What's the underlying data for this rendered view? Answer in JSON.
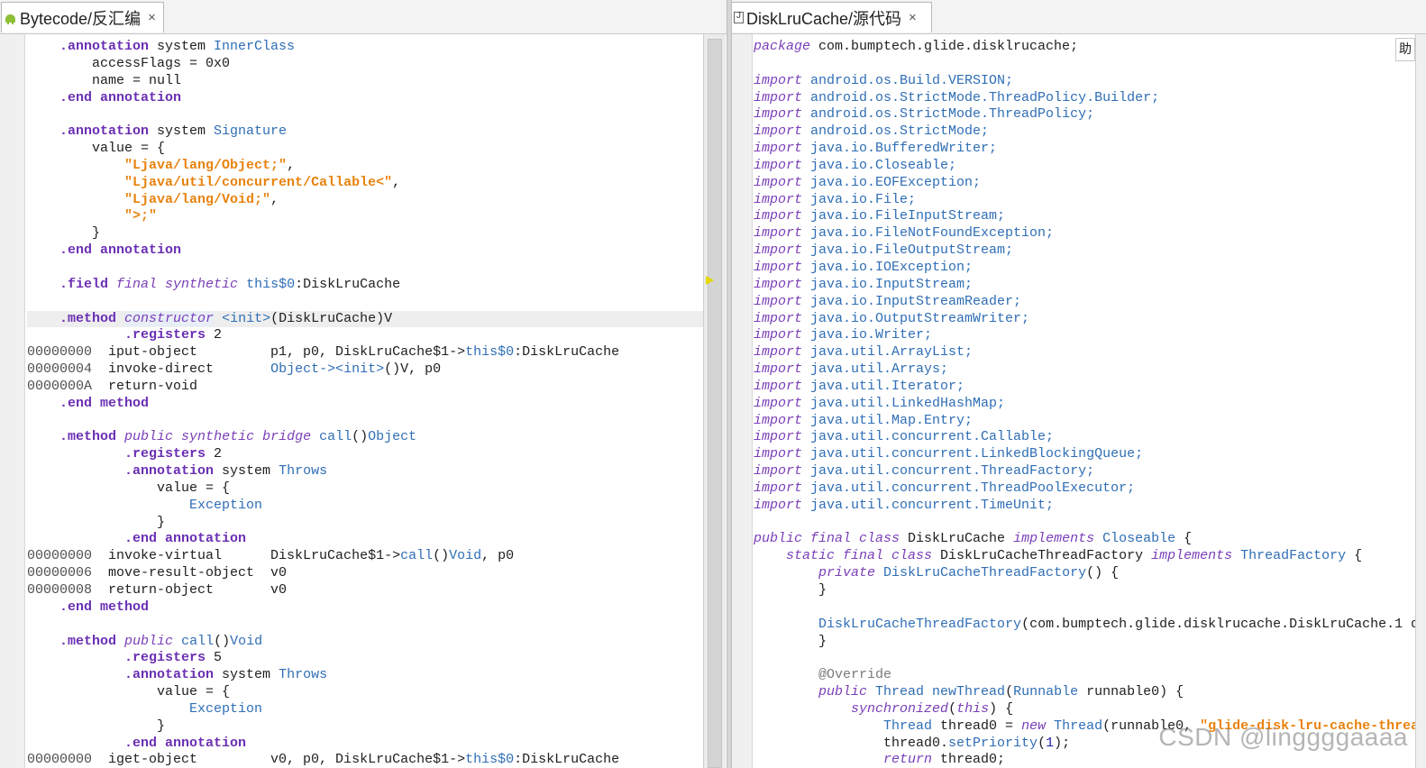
{
  "left_tab": {
    "label": "Bytecode/反汇编",
    "close": "×",
    "icon": "android-icon"
  },
  "right_tab": {
    "label": "DiskLruCache/源代码",
    "close": "×",
    "icon": "java-file-icon"
  },
  "side_glyph": "助",
  "watermark": "CSDN @linggggaaaa",
  "colors": {
    "directive": "#6a2fb3",
    "keyword": "#7a3fb8",
    "type": "#2f6eb5",
    "string": "#e8820e",
    "scroll_marker": "#e6d800"
  },
  "bytecode_lines": [
    [
      [
        "    .annotation",
        "dir"
      ],
      [
        " system ",
        "plain"
      ],
      [
        "InnerClass",
        "type"
      ]
    ],
    [
      [
        "        accessFlags = 0x0",
        "plain"
      ]
    ],
    [
      [
        "        name = null",
        "plain"
      ]
    ],
    [
      [
        "    .end annotation",
        "dir"
      ]
    ],
    [
      [
        "",
        "plain"
      ]
    ],
    [
      [
        "    .annotation",
        "dir"
      ],
      [
        " system ",
        "plain"
      ],
      [
        "Signature",
        "type"
      ]
    ],
    [
      [
        "        value = {",
        "plain"
      ]
    ],
    [
      [
        "            ",
        "plain"
      ],
      [
        "\"Ljava/lang/Object;\"",
        "str"
      ],
      [
        ",",
        "plain"
      ]
    ],
    [
      [
        "            ",
        "plain"
      ],
      [
        "\"Ljava/util/concurrent/Callable<\"",
        "str"
      ],
      [
        ",",
        "plain"
      ]
    ],
    [
      [
        "            ",
        "plain"
      ],
      [
        "\"Ljava/lang/Void;\"",
        "str"
      ],
      [
        ",",
        "plain"
      ]
    ],
    [
      [
        "            ",
        "plain"
      ],
      [
        "\">;\"",
        "str"
      ]
    ],
    [
      [
        "        }",
        "plain"
      ]
    ],
    [
      [
        "    .end annotation",
        "dir"
      ]
    ],
    [
      [
        "",
        "plain"
      ]
    ],
    [
      [
        "    .field",
        "dir"
      ],
      [
        " ",
        "plain"
      ],
      [
        "final synthetic",
        "kw"
      ],
      [
        " this$0",
        "ref"
      ],
      [
        ":DiskLruCache",
        "plain"
      ]
    ],
    [
      [
        "",
        "plain"
      ]
    ],
    [
      [
        "    .method",
        "dir"
      ],
      [
        " ",
        "plain"
      ],
      [
        "constructor",
        "sel"
      ],
      [
        " <init>",
        "ref"
      ],
      [
        "(DiskLruCache)V",
        "plain"
      ]
    ],
    [
      [
        "            .registers",
        "dir"
      ],
      [
        " 2",
        "plain"
      ]
    ],
    [
      [
        "00000000",
        "off"
      ],
      [
        "  iput-object         p1, p0, DiskLruCache$1->",
        "plain"
      ],
      [
        "this$0",
        "ref"
      ],
      [
        ":DiskLruCache",
        "plain"
      ]
    ],
    [
      [
        "00000004",
        "off"
      ],
      [
        "  invoke-direct       ",
        "plain"
      ],
      [
        "Object-><init>",
        "ref"
      ],
      [
        "()V, p0",
        "plain"
      ]
    ],
    [
      [
        "0000000A",
        "off"
      ],
      [
        "  return-void",
        "plain"
      ]
    ],
    [
      [
        "    .end method",
        "dir"
      ]
    ],
    [
      [
        "",
        "plain"
      ]
    ],
    [
      [
        "    .method",
        "dir"
      ],
      [
        " ",
        "plain"
      ],
      [
        "public synthetic bridge",
        "kw"
      ],
      [
        " call",
        "ref"
      ],
      [
        "()",
        "plain"
      ],
      [
        "Object",
        "type"
      ]
    ],
    [
      [
        "            .registers",
        "dir"
      ],
      [
        " 2",
        "plain"
      ]
    ],
    [
      [
        "            .annotation",
        "dir"
      ],
      [
        " system ",
        "plain"
      ],
      [
        "Throws",
        "type"
      ]
    ],
    [
      [
        "                value = {",
        "plain"
      ]
    ],
    [
      [
        "                    ",
        "plain"
      ],
      [
        "Exception",
        "type"
      ]
    ],
    [
      [
        "                }",
        "plain"
      ]
    ],
    [
      [
        "            .end annotation",
        "dir"
      ]
    ],
    [
      [
        "00000000",
        "off"
      ],
      [
        "  invoke-virtual      DiskLruCache$1->",
        "plain"
      ],
      [
        "call",
        "ref"
      ],
      [
        "()",
        "plain"
      ],
      [
        "Void",
        "type"
      ],
      [
        ", p0",
        "plain"
      ]
    ],
    [
      [
        "00000006",
        "off"
      ],
      [
        "  move-result-object  v0",
        "plain"
      ]
    ],
    [
      [
        "00000008",
        "off"
      ],
      [
        "  return-object       v0",
        "plain"
      ]
    ],
    [
      [
        "    .end method",
        "dir"
      ]
    ],
    [
      [
        "",
        "plain"
      ]
    ],
    [
      [
        "    .method",
        "dir"
      ],
      [
        " ",
        "plain"
      ],
      [
        "public",
        "kw"
      ],
      [
        " call",
        "ref"
      ],
      [
        "()",
        "plain"
      ],
      [
        "Void",
        "type"
      ]
    ],
    [
      [
        "            .registers",
        "dir"
      ],
      [
        " 5",
        "plain"
      ]
    ],
    [
      [
        "            .annotation",
        "dir"
      ],
      [
        " system ",
        "plain"
      ],
      [
        "Throws",
        "type"
      ]
    ],
    [
      [
        "                value = {",
        "plain"
      ]
    ],
    [
      [
        "                    ",
        "plain"
      ],
      [
        "Exception",
        "type"
      ]
    ],
    [
      [
        "                }",
        "plain"
      ]
    ],
    [
      [
        "            .end annotation",
        "dir"
      ]
    ],
    [
      [
        "00000000",
        "off"
      ],
      [
        "  iget-object         v0, p0, DiskLruCache$1->",
        "plain"
      ],
      [
        "this$0",
        "ref"
      ],
      [
        ":DiskLruCache",
        "plain"
      ]
    ]
  ],
  "source_lines": [
    [
      [
        "package",
        "kw"
      ],
      [
        " com.bumptech.glide.disklrucache;",
        "plain"
      ]
    ],
    [
      [
        "",
        "plain"
      ]
    ],
    [
      [
        "import",
        "kw"
      ],
      [
        " android.os.Build.VERSION;",
        "ref"
      ]
    ],
    [
      [
        "import",
        "kw"
      ],
      [
        " android.os.StrictMode.ThreadPolicy.Builder;",
        "ref"
      ]
    ],
    [
      [
        "import",
        "kw"
      ],
      [
        " android.os.StrictMode.ThreadPolicy;",
        "ref"
      ]
    ],
    [
      [
        "import",
        "kw"
      ],
      [
        " android.os.StrictMode;",
        "ref"
      ]
    ],
    [
      [
        "import",
        "kw"
      ],
      [
        " java.io.BufferedWriter;",
        "ref"
      ]
    ],
    [
      [
        "import",
        "kw"
      ],
      [
        " java.io.Closeable;",
        "ref"
      ]
    ],
    [
      [
        "import",
        "kw"
      ],
      [
        " java.io.EOFException;",
        "ref"
      ]
    ],
    [
      [
        "import",
        "kw"
      ],
      [
        " java.io.File;",
        "ref"
      ]
    ],
    [
      [
        "import",
        "kw"
      ],
      [
        " java.io.FileInputStream;",
        "ref"
      ]
    ],
    [
      [
        "import",
        "kw"
      ],
      [
        " java.io.FileNotFoundException;",
        "ref"
      ]
    ],
    [
      [
        "import",
        "kw"
      ],
      [
        " java.io.FileOutputStream;",
        "ref"
      ]
    ],
    [
      [
        "import",
        "kw"
      ],
      [
        " java.io.IOException;",
        "ref"
      ]
    ],
    [
      [
        "import",
        "kw"
      ],
      [
        " java.io.InputStream;",
        "ref"
      ]
    ],
    [
      [
        "import",
        "kw"
      ],
      [
        " java.io.InputStreamReader;",
        "ref"
      ]
    ],
    [
      [
        "import",
        "kw"
      ],
      [
        " java.io.OutputStreamWriter;",
        "ref"
      ]
    ],
    [
      [
        "import",
        "kw"
      ],
      [
        " java.io.Writer;",
        "ref"
      ]
    ],
    [
      [
        "import",
        "kw"
      ],
      [
        " java.util.ArrayList;",
        "ref"
      ]
    ],
    [
      [
        "import",
        "kw"
      ],
      [
        " java.util.Arrays;",
        "ref"
      ]
    ],
    [
      [
        "import",
        "kw"
      ],
      [
        " java.util.Iterator;",
        "ref"
      ]
    ],
    [
      [
        "import",
        "kw"
      ],
      [
        " java.util.LinkedHashMap;",
        "ref"
      ]
    ],
    [
      [
        "import",
        "kw"
      ],
      [
        " java.util.Map.Entry;",
        "ref"
      ]
    ],
    [
      [
        "import",
        "kw"
      ],
      [
        " java.util.concurrent.Callable;",
        "ref"
      ]
    ],
    [
      [
        "import",
        "kw"
      ],
      [
        " java.util.concurrent.LinkedBlockingQueue;",
        "ref"
      ]
    ],
    [
      [
        "import",
        "kw"
      ],
      [
        " java.util.concurrent.ThreadFactory;",
        "ref"
      ]
    ],
    [
      [
        "import",
        "kw"
      ],
      [
        " java.util.concurrent.ThreadPoolExecutor;",
        "ref"
      ]
    ],
    [
      [
        "import",
        "kw"
      ],
      [
        " java.util.concurrent.TimeUnit;",
        "ref"
      ]
    ],
    [
      [
        "",
        "plain"
      ]
    ],
    [
      [
        "public final class",
        "kw"
      ],
      [
        " DiskLruCache ",
        "plain"
      ],
      [
        "implements",
        "kw"
      ],
      [
        " Closeable",
        "type"
      ],
      [
        " {",
        "plain"
      ]
    ],
    [
      [
        "    ",
        "plain"
      ],
      [
        "static final class",
        "kw"
      ],
      [
        " DiskLruCacheThreadFactory ",
        "plain"
      ],
      [
        "implements",
        "kw"
      ],
      [
        " ThreadFactory",
        "type"
      ],
      [
        " {",
        "plain"
      ]
    ],
    [
      [
        "        ",
        "plain"
      ],
      [
        "private",
        "kw"
      ],
      [
        " DiskLruCacheThreadFactory",
        "ref"
      ],
      [
        "() {",
        "plain"
      ]
    ],
    [
      [
        "        }",
        "plain"
      ]
    ],
    [
      [
        "",
        "plain"
      ]
    ],
    [
      [
        "        ",
        "plain"
      ],
      [
        "DiskLruCacheThreadFactory",
        "ref"
      ],
      [
        "(com.bumptech.glide.disklrucache.DiskLruCache.1 d",
        "plain"
      ]
    ],
    [
      [
        "        }",
        "plain"
      ]
    ],
    [
      [
        "",
        "plain"
      ]
    ],
    [
      [
        "        ",
        "plain"
      ],
      [
        "@Override",
        "cmt"
      ]
    ],
    [
      [
        "        ",
        "plain"
      ],
      [
        "public",
        "kw"
      ],
      [
        " Thread",
        "type"
      ],
      [
        " newThread",
        "ref"
      ],
      [
        "(",
        "plain"
      ],
      [
        "Runnable",
        "type"
      ],
      [
        " runnable0) {",
        "plain"
      ]
    ],
    [
      [
        "            ",
        "plain"
      ],
      [
        "synchronized",
        "kw"
      ],
      [
        "(",
        "plain"
      ],
      [
        "this",
        "kw"
      ],
      [
        ") {",
        "plain"
      ]
    ],
    [
      [
        "                ",
        "plain"
      ],
      [
        "Thread",
        "type"
      ],
      [
        " thread0 = ",
        "plain"
      ],
      [
        "new",
        "kw"
      ],
      [
        " Thread",
        "type"
      ],
      [
        "(runnable0, ",
        "plain"
      ],
      [
        "\"glide-disk-lru-cache-threa",
        "str"
      ]
    ],
    [
      [
        "                thread0.",
        "plain"
      ],
      [
        "setPriority",
        "ref"
      ],
      [
        "(",
        "plain"
      ],
      [
        "1",
        "num"
      ],
      [
        ");",
        "plain"
      ]
    ],
    [
      [
        "                ",
        "plain"
      ],
      [
        "return",
        "kw"
      ],
      [
        " thread0;",
        "plain"
      ]
    ]
  ]
}
